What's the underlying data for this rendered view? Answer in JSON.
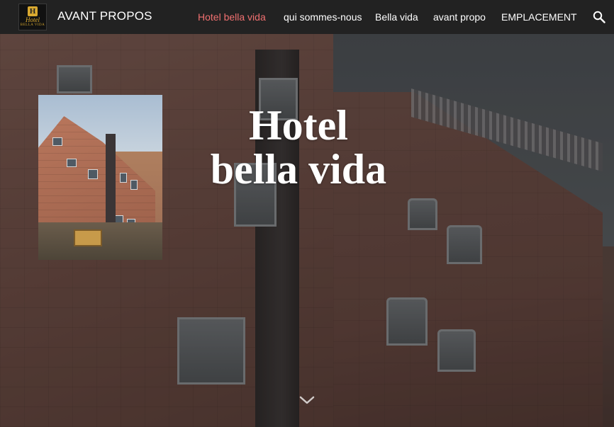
{
  "navbar": {
    "logo": {
      "mark": "H",
      "line1": "Hotel",
      "line2": "BELLA VIDA"
    },
    "brand": "AVANT PROPOS",
    "items": [
      {
        "label": "Hotel bella vida",
        "active": true
      },
      {
        "label": "qui sommes-nous",
        "active": false
      },
      {
        "label": "Bella vida",
        "active": false
      },
      {
        "label": "avant propo",
        "active": false
      },
      {
        "label": "EMPLACEMENT",
        "active": false
      }
    ],
    "search_icon": "search-icon"
  },
  "hero": {
    "title_line1": "Hotel",
    "title_line2": "bella vida",
    "scroll_icon": "chevron-down-icon"
  },
  "colors": {
    "navbar_bg": "#222222",
    "active_link": "#f07070",
    "text": "#ffffff",
    "logo_gold": "#d9a930"
  }
}
